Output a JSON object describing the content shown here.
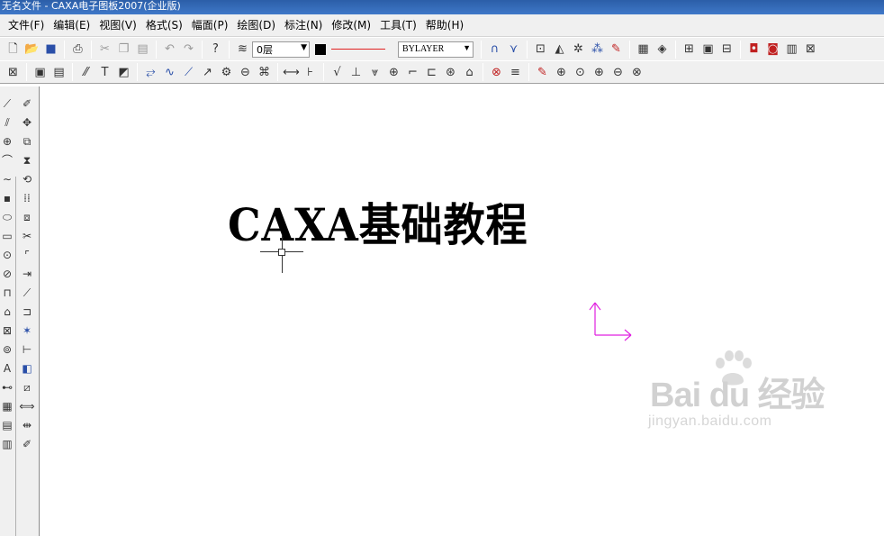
{
  "window": {
    "title": "无名文件 - CAXA电子图板2007(企业版)"
  },
  "menu": [
    "文件(F)",
    "编辑(E)",
    "视图(V)",
    "格式(S)",
    "幅面(P)",
    "绘图(D)",
    "标注(N)",
    "修改(M)",
    "工具(T)",
    "帮助(H)"
  ],
  "properties": {
    "layer": "0层",
    "linewidth": "BYLAYER",
    "current_color": "#000000",
    "linetype_color": "#e02020"
  },
  "drawing": {
    "text": "CAXA基础教程"
  },
  "watermark": {
    "brand": "Bai du 经验",
    "url": "jingyan.baidu.com"
  },
  "colors": {
    "ucs": "#e020e0",
    "watermark": "#c9c9c9"
  }
}
